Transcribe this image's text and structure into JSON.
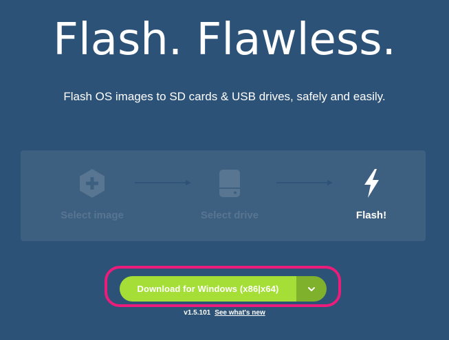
{
  "hero": {
    "title": "Flash. Flawless.",
    "subtitle": "Flash OS images to SD cards & USB drives, safely and easily."
  },
  "steps": [
    {
      "label": "Select image",
      "icon": "hexagon-plus-icon",
      "state": "disabled"
    },
    {
      "label": "Select drive",
      "icon": "drive-icon",
      "state": "disabled"
    },
    {
      "label": "Flash!",
      "icon": "lightning-bolt-icon",
      "state": "active"
    }
  ],
  "download": {
    "button_label": "Download for Windows (x86|x64)",
    "dropdown_icon": "chevron-down-icon"
  },
  "version": {
    "number": "v1.5.101",
    "whats_new_link": "See what's new"
  },
  "colors": {
    "background": "#2d5277",
    "panel": "#3d5f80",
    "disabled_text": "#587592",
    "download_green": "#a5de37",
    "dropdown_green": "#7fb12d",
    "highlight": "#ec1c7a"
  }
}
